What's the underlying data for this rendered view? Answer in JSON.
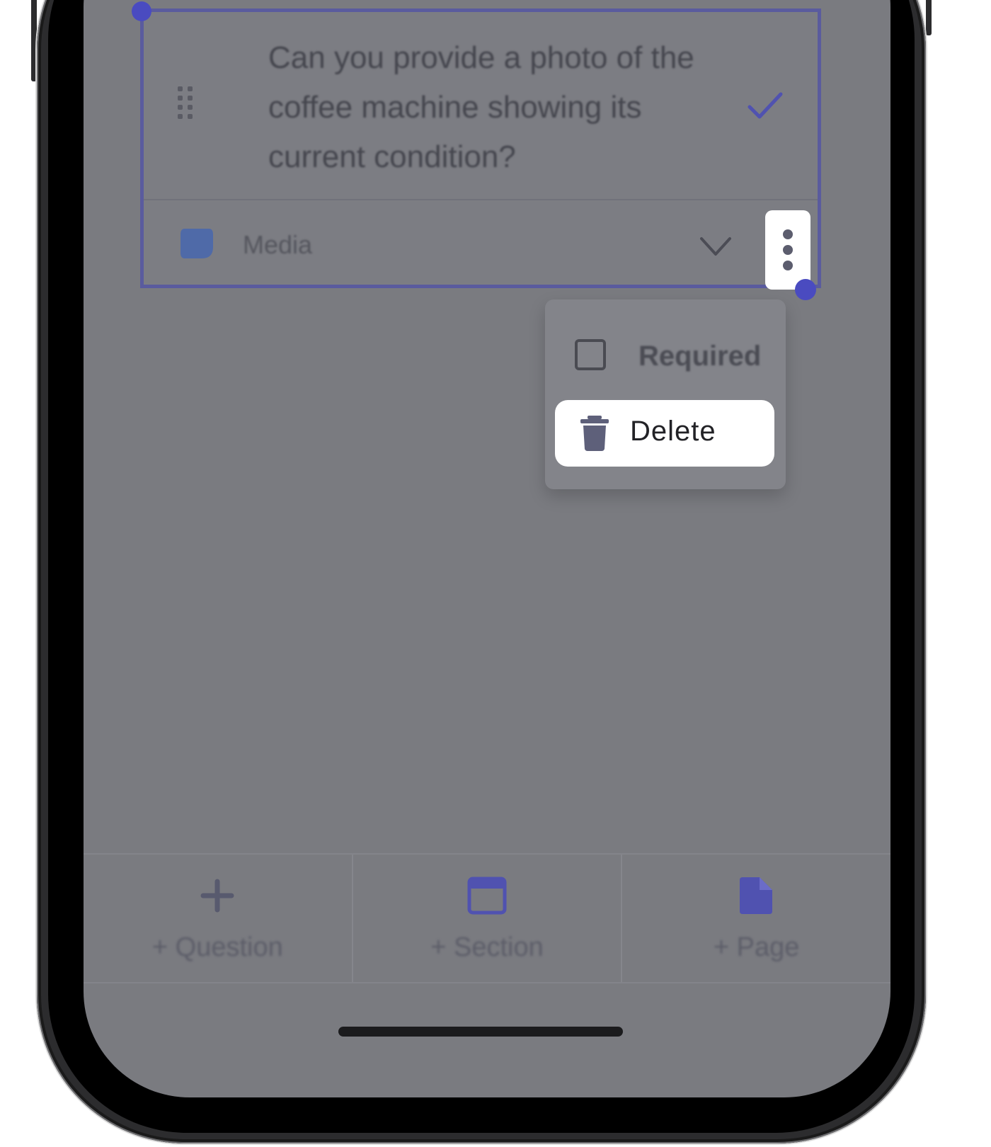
{
  "question": {
    "text": "Can you provide a photo of the coffee machine showing its current condition?",
    "type_label": "Media",
    "icons": [
      "drag-handle-icon",
      "check-icon",
      "media-icon",
      "chevron-down-icon",
      "more-vertical-icon"
    ]
  },
  "menu": {
    "required_label": "Required",
    "required_checked": false,
    "delete_label": "Delete"
  },
  "bottom_bar": {
    "items": [
      {
        "label": "+ Question",
        "icon": "plus-icon"
      },
      {
        "label": "+ Section",
        "icon": "section-icon"
      },
      {
        "label": "+ Page",
        "icon": "page-icon"
      }
    ]
  },
  "colors": {
    "accent": "#4a4bc0",
    "overlay": "#7a7b80",
    "menu_highlight": "#ffffff"
  }
}
